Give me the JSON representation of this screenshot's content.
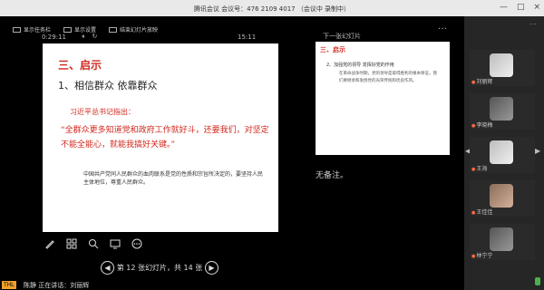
{
  "window": {
    "title": "腾讯会议 会议号：476 2109 4017 （会议中 录制中）",
    "buttons": [
      "—",
      "□",
      "×"
    ]
  },
  "toolbar": {
    "items": [
      {
        "label": "显示任务栏",
        "icon": "taskbar-icon"
      },
      {
        "label": "显示设置",
        "icon": "display-icon"
      },
      {
        "label": "结束幻灯片放映",
        "icon": "end-show-icon"
      }
    ],
    "more": "…"
  },
  "presenter": {
    "timer": "0:29:11",
    "timer_controls": [
      "⏸",
      "↻"
    ],
    "clock": "15:11"
  },
  "slide": {
    "heading": "三、启示",
    "subheading": "1、相信群众 依靠群众",
    "note": "习近平总书记指出：",
    "quote": "“全群众更多知道党和政府工作就好斗，还要我们，对坚定不能全能心，就能我搞好关键。”",
    "small": "中国共产党同人民群众的血肉联系是党的性质和宗旨所决定的，要坚持人民主体地位，尊重人民群众。"
  },
  "next": {
    "label": "下一张幻灯片",
    "heading": "三、启示",
    "subheading": "2、加强党的领导 发挥好党的作用",
    "body": "在革命战争时期，党的领导是取得胜利的根本保证，我们要继承和发扬党的光荣传统和优良作风。"
  },
  "notes_text": "无备注。",
  "tools": [
    "pen-icon",
    "grid-icon",
    "zoom-icon",
    "screen-icon",
    "more-icon"
  ],
  "pager": {
    "text": "第 12 张幻灯片，共 14 张",
    "prev": "◀",
    "next": "▶"
  },
  "sidebar": {
    "more": "…",
    "participants": [
      "刘丽辉",
      "李晓梅",
      "王海",
      "王佳佳",
      "林宁宁"
    ],
    "nav_prev": "◀",
    "nav_next": "▶"
  },
  "statusbar": {
    "badge": "THL",
    "text": "陈静 正在讲话：刘丽辉"
  }
}
